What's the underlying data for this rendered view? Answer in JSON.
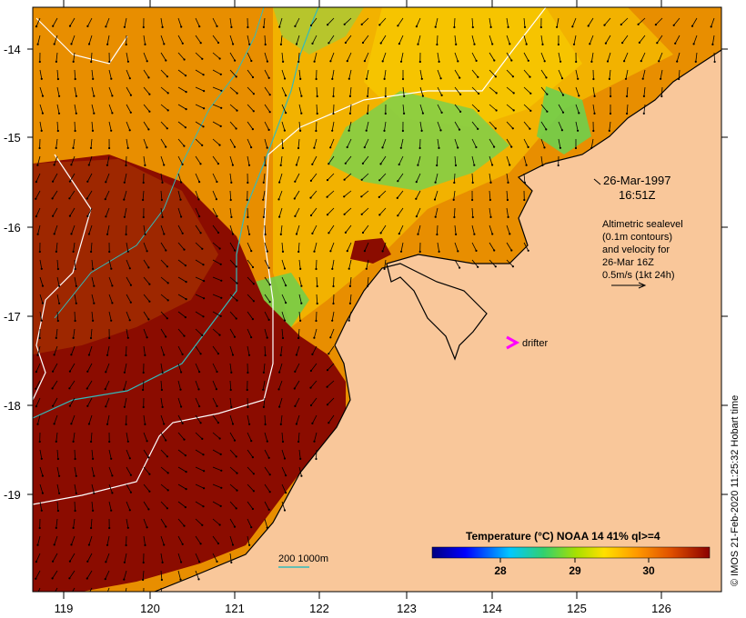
{
  "colors": {
    "land": "#F9C79A",
    "ocean_warm": "#8B0C00",
    "ocean_mid": "#E06A00",
    "ocean_cool": "#F0A800",
    "ocean_cooler": "#FFD200",
    "ocean_cold": "#6FD24A",
    "contour": "#FFFFFF",
    "bathymetry": "#33BBBB",
    "drifter": "#FF00FF",
    "vector": "#000000"
  },
  "axes": {
    "x_ticks": [
      "119",
      "120",
      "121",
      "122",
      "123",
      "124",
      "125",
      "126"
    ],
    "y_ticks": [
      "-14",
      "-15",
      "-16",
      "-17",
      "-18",
      "-19"
    ]
  },
  "annotations": {
    "date": "26-Mar-1997",
    "time": "16:51Z",
    "legend_lines": [
      "Altimetric sealevel",
      "(0.1m contours)",
      "and velocity for",
      "26-Mar 16Z",
      "0.5m/s (1kt 24h)"
    ],
    "drifter_label": "drifter",
    "bathy_label": "200  1000m"
  },
  "colorbar": {
    "title": "Temperature (°C) NOAA 14 41% ql>=4",
    "ticks": [
      "28",
      "29",
      "30"
    ]
  },
  "credit": "© IMOS 21-Feb-2020 11:25:32 Hobart time"
}
